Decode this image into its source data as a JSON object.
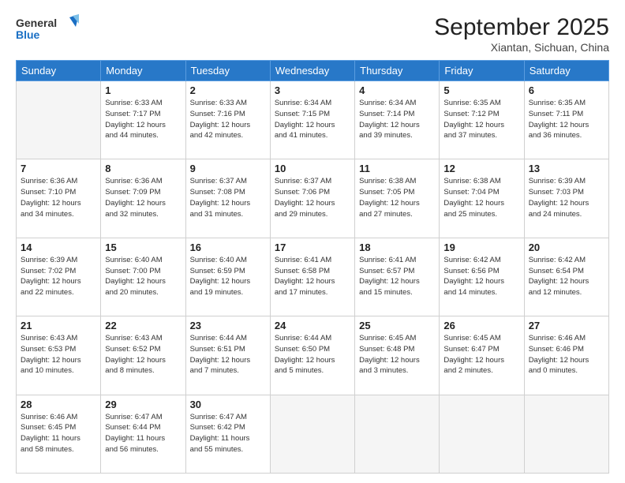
{
  "header": {
    "logo_general": "General",
    "logo_blue": "Blue",
    "month": "September 2025",
    "location": "Xiantan, Sichuan, China"
  },
  "weekdays": [
    "Sunday",
    "Monday",
    "Tuesday",
    "Wednesday",
    "Thursday",
    "Friday",
    "Saturday"
  ],
  "weeks": [
    [
      {
        "day": "",
        "info": ""
      },
      {
        "day": "1",
        "info": "Sunrise: 6:33 AM\nSunset: 7:17 PM\nDaylight: 12 hours\nand 44 minutes."
      },
      {
        "day": "2",
        "info": "Sunrise: 6:33 AM\nSunset: 7:16 PM\nDaylight: 12 hours\nand 42 minutes."
      },
      {
        "day": "3",
        "info": "Sunrise: 6:34 AM\nSunset: 7:15 PM\nDaylight: 12 hours\nand 41 minutes."
      },
      {
        "day": "4",
        "info": "Sunrise: 6:34 AM\nSunset: 7:14 PM\nDaylight: 12 hours\nand 39 minutes."
      },
      {
        "day": "5",
        "info": "Sunrise: 6:35 AM\nSunset: 7:12 PM\nDaylight: 12 hours\nand 37 minutes."
      },
      {
        "day": "6",
        "info": "Sunrise: 6:35 AM\nSunset: 7:11 PM\nDaylight: 12 hours\nand 36 minutes."
      }
    ],
    [
      {
        "day": "7",
        "info": "Sunrise: 6:36 AM\nSunset: 7:10 PM\nDaylight: 12 hours\nand 34 minutes."
      },
      {
        "day": "8",
        "info": "Sunrise: 6:36 AM\nSunset: 7:09 PM\nDaylight: 12 hours\nand 32 minutes."
      },
      {
        "day": "9",
        "info": "Sunrise: 6:37 AM\nSunset: 7:08 PM\nDaylight: 12 hours\nand 31 minutes."
      },
      {
        "day": "10",
        "info": "Sunrise: 6:37 AM\nSunset: 7:06 PM\nDaylight: 12 hours\nand 29 minutes."
      },
      {
        "day": "11",
        "info": "Sunrise: 6:38 AM\nSunset: 7:05 PM\nDaylight: 12 hours\nand 27 minutes."
      },
      {
        "day": "12",
        "info": "Sunrise: 6:38 AM\nSunset: 7:04 PM\nDaylight: 12 hours\nand 25 minutes."
      },
      {
        "day": "13",
        "info": "Sunrise: 6:39 AM\nSunset: 7:03 PM\nDaylight: 12 hours\nand 24 minutes."
      }
    ],
    [
      {
        "day": "14",
        "info": "Sunrise: 6:39 AM\nSunset: 7:02 PM\nDaylight: 12 hours\nand 22 minutes."
      },
      {
        "day": "15",
        "info": "Sunrise: 6:40 AM\nSunset: 7:00 PM\nDaylight: 12 hours\nand 20 minutes."
      },
      {
        "day": "16",
        "info": "Sunrise: 6:40 AM\nSunset: 6:59 PM\nDaylight: 12 hours\nand 19 minutes."
      },
      {
        "day": "17",
        "info": "Sunrise: 6:41 AM\nSunset: 6:58 PM\nDaylight: 12 hours\nand 17 minutes."
      },
      {
        "day": "18",
        "info": "Sunrise: 6:41 AM\nSunset: 6:57 PM\nDaylight: 12 hours\nand 15 minutes."
      },
      {
        "day": "19",
        "info": "Sunrise: 6:42 AM\nSunset: 6:56 PM\nDaylight: 12 hours\nand 14 minutes."
      },
      {
        "day": "20",
        "info": "Sunrise: 6:42 AM\nSunset: 6:54 PM\nDaylight: 12 hours\nand 12 minutes."
      }
    ],
    [
      {
        "day": "21",
        "info": "Sunrise: 6:43 AM\nSunset: 6:53 PM\nDaylight: 12 hours\nand 10 minutes."
      },
      {
        "day": "22",
        "info": "Sunrise: 6:43 AM\nSunset: 6:52 PM\nDaylight: 12 hours\nand 8 minutes."
      },
      {
        "day": "23",
        "info": "Sunrise: 6:44 AM\nSunset: 6:51 PM\nDaylight: 12 hours\nand 7 minutes."
      },
      {
        "day": "24",
        "info": "Sunrise: 6:44 AM\nSunset: 6:50 PM\nDaylight: 12 hours\nand 5 minutes."
      },
      {
        "day": "25",
        "info": "Sunrise: 6:45 AM\nSunset: 6:48 PM\nDaylight: 12 hours\nand 3 minutes."
      },
      {
        "day": "26",
        "info": "Sunrise: 6:45 AM\nSunset: 6:47 PM\nDaylight: 12 hours\nand 2 minutes."
      },
      {
        "day": "27",
        "info": "Sunrise: 6:46 AM\nSunset: 6:46 PM\nDaylight: 12 hours\nand 0 minutes."
      }
    ],
    [
      {
        "day": "28",
        "info": "Sunrise: 6:46 AM\nSunset: 6:45 PM\nDaylight: 11 hours\nand 58 minutes."
      },
      {
        "day": "29",
        "info": "Sunrise: 6:47 AM\nSunset: 6:44 PM\nDaylight: 11 hours\nand 56 minutes."
      },
      {
        "day": "30",
        "info": "Sunrise: 6:47 AM\nSunset: 6:42 PM\nDaylight: 11 hours\nand 55 minutes."
      },
      {
        "day": "",
        "info": ""
      },
      {
        "day": "",
        "info": ""
      },
      {
        "day": "",
        "info": ""
      },
      {
        "day": "",
        "info": ""
      }
    ]
  ]
}
